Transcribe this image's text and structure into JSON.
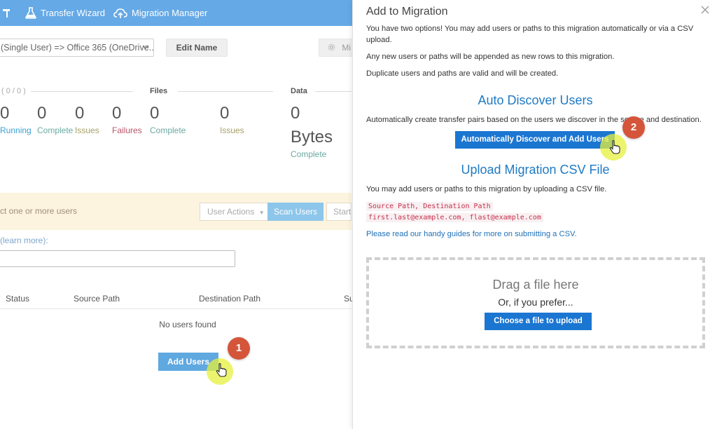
{
  "nav": {
    "transfer_wizard": "Transfer Wizard",
    "migration_manager": "Migration Manager"
  },
  "toolbar": {
    "migration_select_value": "(Single User) => Office 365 (OneDrive...",
    "edit_name": "Edit Name",
    "settings_partial": "Mi"
  },
  "summary": {
    "users_header": "( 0 / 0 )",
    "files_header": "Files",
    "data_header": "Data",
    "users": [
      {
        "value": "0",
        "label": "Running"
      },
      {
        "value": "0",
        "label": "Complete"
      },
      {
        "value": "0",
        "label": "Issues"
      },
      {
        "value": "0",
        "label": "Failures"
      }
    ],
    "files": [
      {
        "value": "0",
        "label": "Complete"
      },
      {
        "value": "0",
        "label": "Issues"
      }
    ],
    "data": {
      "value": "0",
      "unit": "Bytes",
      "label": "Complete"
    }
  },
  "actions": {
    "hint": "ct one or more users",
    "user_actions": "User Actions",
    "scan_users": "Scan Users",
    "start_partial": "Start"
  },
  "learn_more": "(learn more):",
  "table": {
    "headers": [
      "Status",
      "Source Path",
      "Destination Path",
      "Su"
    ],
    "empty": "No users found",
    "add_users": "Add Users"
  },
  "panel": {
    "title": "Add to Migration",
    "intro_line1": "You have two options! You may add users or paths to this migration automatically or via a CSV",
    "intro_line2": "upload.",
    "appended": "Any new users or paths will be appended as new rows to this migration.",
    "duplicates": "Duplicate users and paths are valid and will be created.",
    "auto_heading": "Auto Discover Users",
    "auto_desc": "Automatically create transfer pairs based on the users we discover in the source and destination.",
    "auto_button": "Automatically Discover and Add Users",
    "csv_heading": "Upload Migration CSV File",
    "csv_desc": "You may add users or paths to this migration by uploading a CSV file.",
    "csv_example_header": "Source Path, Destination Path",
    "csv_example_row": "first.last@example.com, flast@example.com",
    "guides": "Please read our handy guides for more on submitting a CSV.",
    "drop_title": "Drag a file here",
    "drop_sub": "Or, if you prefer...",
    "choose_file": "Choose a file to upload"
  },
  "callouts": {
    "step1": "1",
    "step2": "2"
  },
  "colors": {
    "topbar": "#65a9e6",
    "primary": "#1b76d1",
    "badge": "#d4553a",
    "highlight": "#e6f03c"
  }
}
